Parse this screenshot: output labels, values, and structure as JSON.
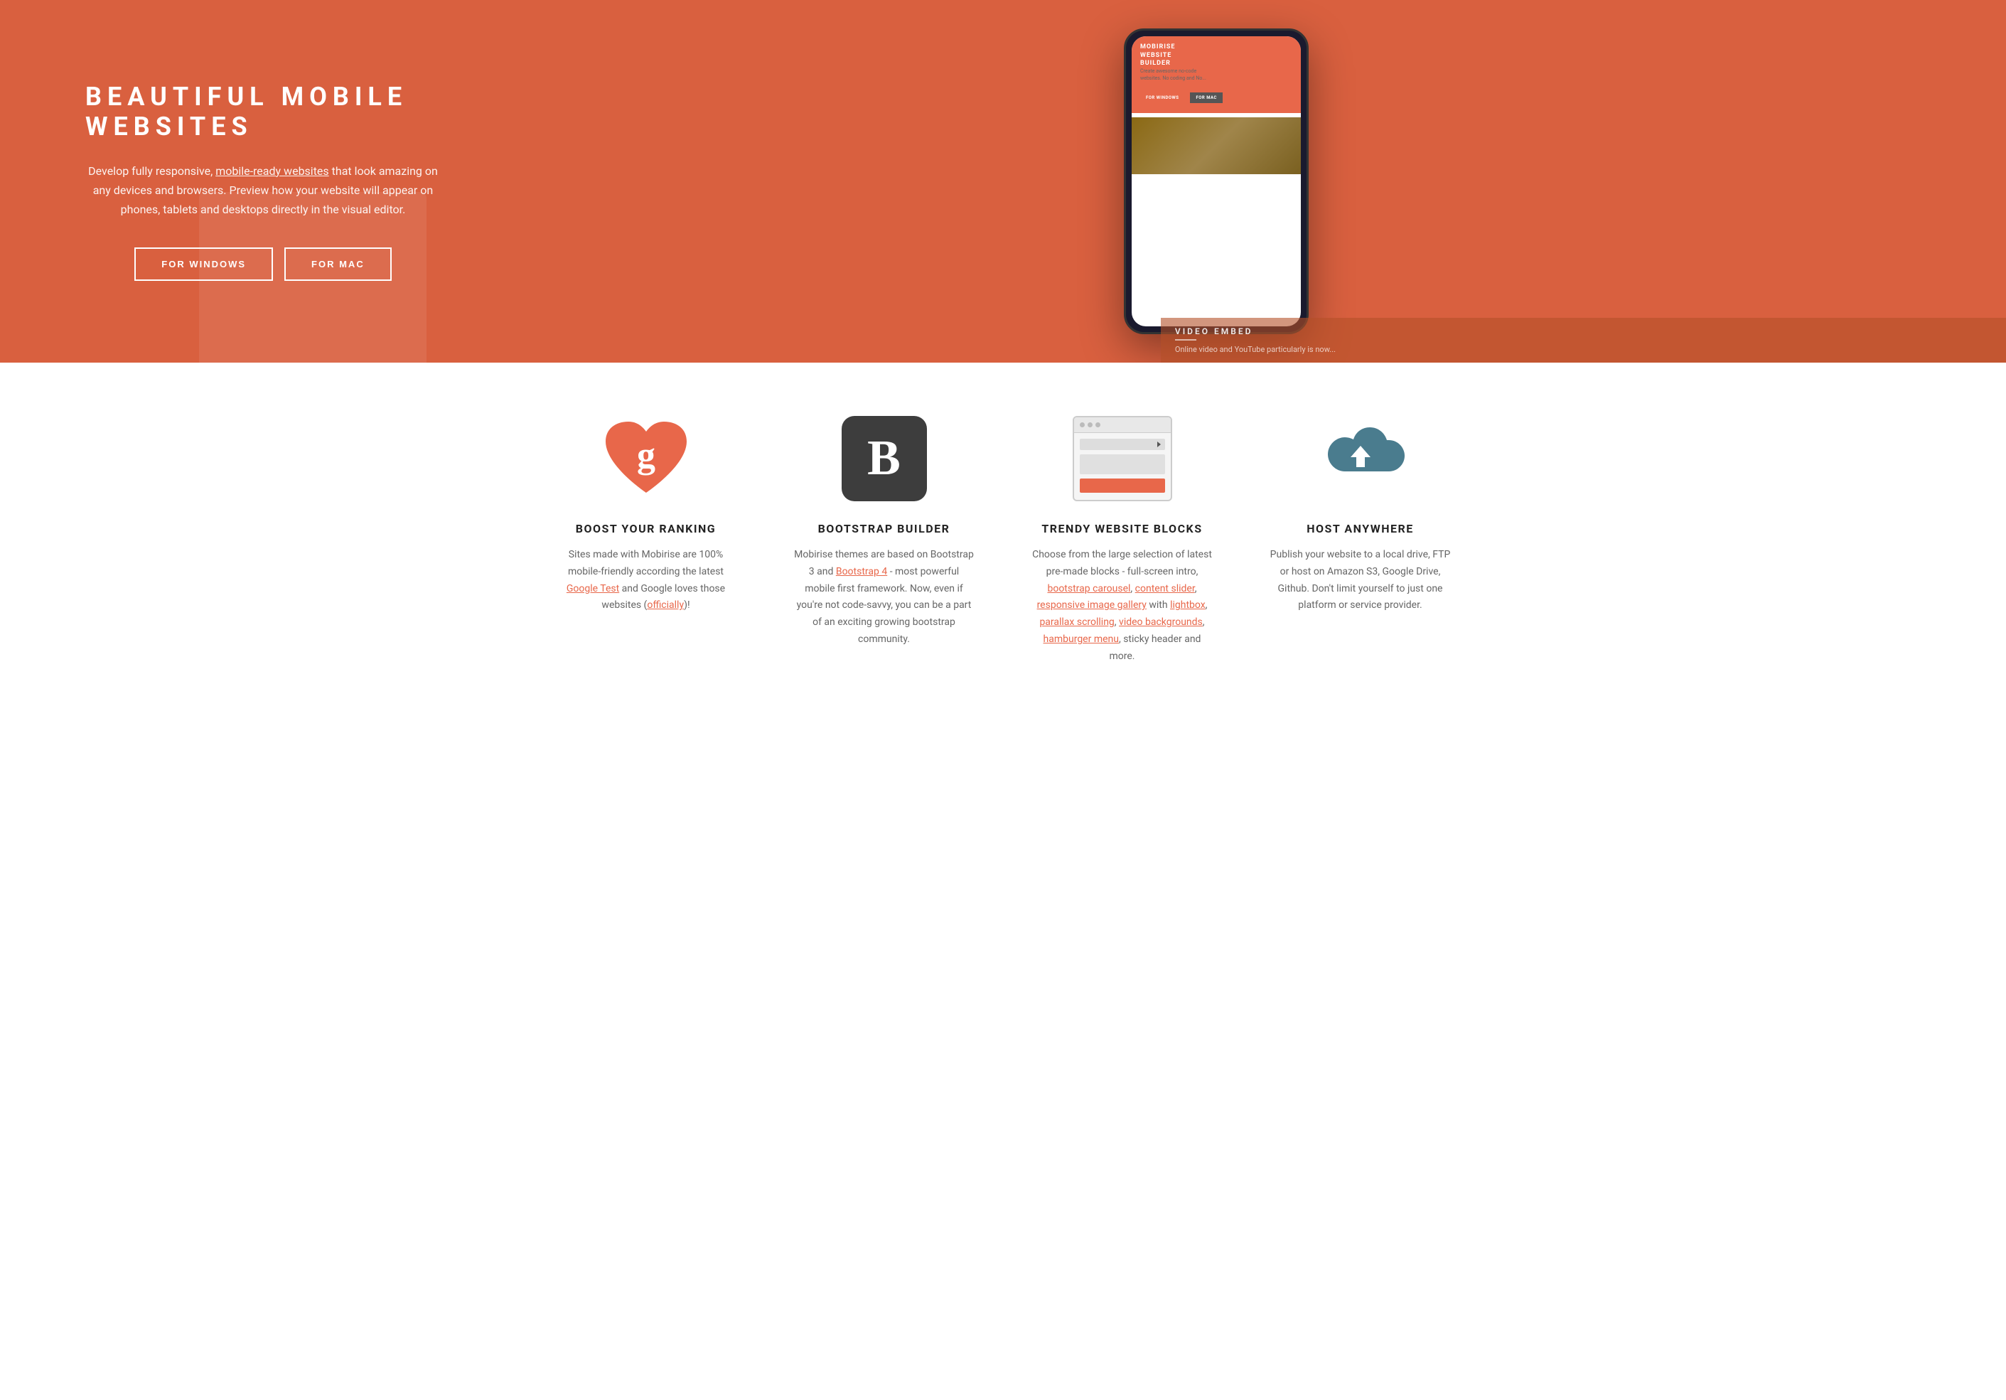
{
  "hero": {
    "title": "BEAUTIFUL MOBILE WEBSITES",
    "description": "Develop fully responsive, mobile-ready websites that look amazing on any devices and browsers. Preview how your website will appear on phones, tablets and desktops directly in the visual editor.",
    "mobile_ready_link": "mobile-ready websites",
    "btn_windows": "FOR WINDOWS",
    "btn_mac": "FOR MAC",
    "phone_screen": {
      "title": "MOBIRISE WEBSITE BUILDER",
      "subtitle": "Create awesome no-code websites. No coding and No...",
      "btn1": "FOR WINDOWS",
      "btn2": "FOR MAC"
    },
    "video_embed": {
      "label": "VIDEO EMBED",
      "description": "Online video and YouTube particularly is now..."
    }
  },
  "features": {
    "items": [
      {
        "id": "boost",
        "icon": "heart-google",
        "title": "BOOST YOUR RANKING",
        "description": "Sites made with Mobirise are 100% mobile-friendly according the latest Google Test and Google loves those websites (officially)!",
        "links": [
          {
            "text": "Google Test",
            "href": "#"
          },
          {
            "text": "officially",
            "href": "#"
          }
        ]
      },
      {
        "id": "bootstrap",
        "icon": "bootstrap-b",
        "title": "BOOTSTRAP BUILDER",
        "description": "Mobirise themes are based on Bootstrap 3 and Bootstrap 4 - most powerful mobile first framework. Now, even if you're not code-savvy, you can be a part of an exciting growing bootstrap community.",
        "links": [
          {
            "text": "Bootstrap 4",
            "href": "#"
          }
        ]
      },
      {
        "id": "trendy",
        "icon": "browser-blocks",
        "title": "TRENDY WEBSITE BLOCKS",
        "description": "Choose from the large selection of latest pre-made blocks - full-screen intro, bootstrap carousel, content slider, responsive image gallery with lightbox, parallax scrolling, video backgrounds, hamburger menu, sticky header and more.",
        "links": [
          {
            "text": "bootstrap carousel",
            "href": "#"
          },
          {
            "text": "content slider",
            "href": "#"
          },
          {
            "text": "responsive image gallery",
            "href": "#"
          },
          {
            "text": "lightbox",
            "href": "#"
          },
          {
            "text": "parallax scrolling",
            "href": "#"
          },
          {
            "text": "video backgrounds",
            "href": "#"
          },
          {
            "text": "hamburger menu",
            "href": "#"
          }
        ]
      },
      {
        "id": "host",
        "icon": "cloud-upload",
        "title": "HOST ANYWHERE",
        "description": "Publish your website to a local drive, FTP or host on Amazon S3, Google Drive, Github. Don't limit yourself to just one platform or service provider.",
        "links": []
      }
    ]
  }
}
